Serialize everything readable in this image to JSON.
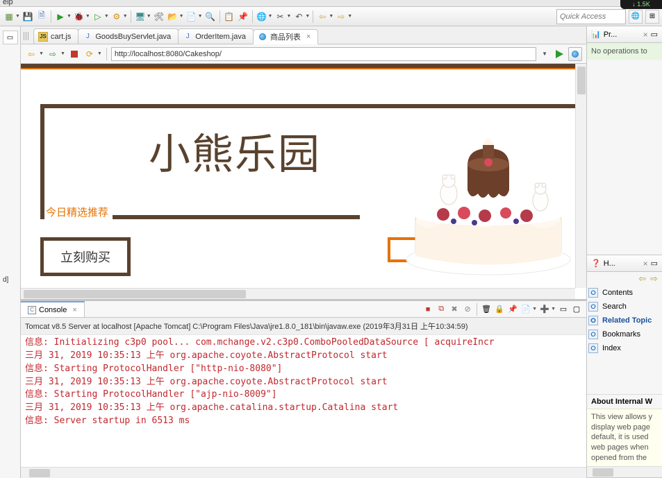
{
  "titlebar": {
    "menu_trunc": "elp",
    "net": "1.5K"
  },
  "quick_access": {
    "placeholder": "Quick Access"
  },
  "editor": {
    "tabs": [
      {
        "label": "cart.js",
        "icon": "js"
      },
      {
        "label": "GoodsBuyServlet.java",
        "icon": "java"
      },
      {
        "label": "OrderItem.java",
        "icon": "java"
      },
      {
        "label": "商品列表",
        "icon": "web",
        "active": true,
        "closable": true
      }
    ],
    "url": "http://localhost:8080/Cakeshop/"
  },
  "page": {
    "title": "小熊乐园",
    "subtitle": "今日精选推荐",
    "cta": "立刻购买"
  },
  "console": {
    "title": "Console",
    "desc": "Tomcat v8.5 Server at localhost [Apache Tomcat] C:\\Program Files\\Java\\jre1.8.0_181\\bin\\javaw.exe (2019年3月31日 上午10:34:59)",
    "lines": [
      "信息: Initializing c3p0 pool... com.mchange.v2.c3p0.ComboPooledDataSource [ acquireIncr",
      "三月 31, 2019 10:35:13 上午 org.apache.coyote.AbstractProtocol start",
      "信息: Starting ProtocolHandler [\"http-nio-8080\"]",
      "三月 31, 2019 10:35:13 上午 org.apache.coyote.AbstractProtocol start",
      "信息: Starting ProtocolHandler [\"ajp-nio-8009\"]",
      "三月 31, 2019 10:35:13 上午 org.apache.catalina.startup.Catalina start",
      "信息: Server startup in 6513 ms"
    ]
  },
  "left_mini": {
    "label": "d]"
  },
  "right": {
    "progress": {
      "title": "Pr...",
      "body": "No operations to"
    },
    "help": {
      "title": "H...",
      "items": [
        {
          "label": "Contents"
        },
        {
          "label": "Search"
        },
        {
          "label": "Related Topic",
          "selected": true
        },
        {
          "label": "Bookmarks"
        },
        {
          "label": "Index"
        }
      ],
      "about_h": "About Internal W",
      "about_b": "This view allows y\ndisplay web page\ndefault, it is used\nweb pages when\nopened from the"
    }
  }
}
